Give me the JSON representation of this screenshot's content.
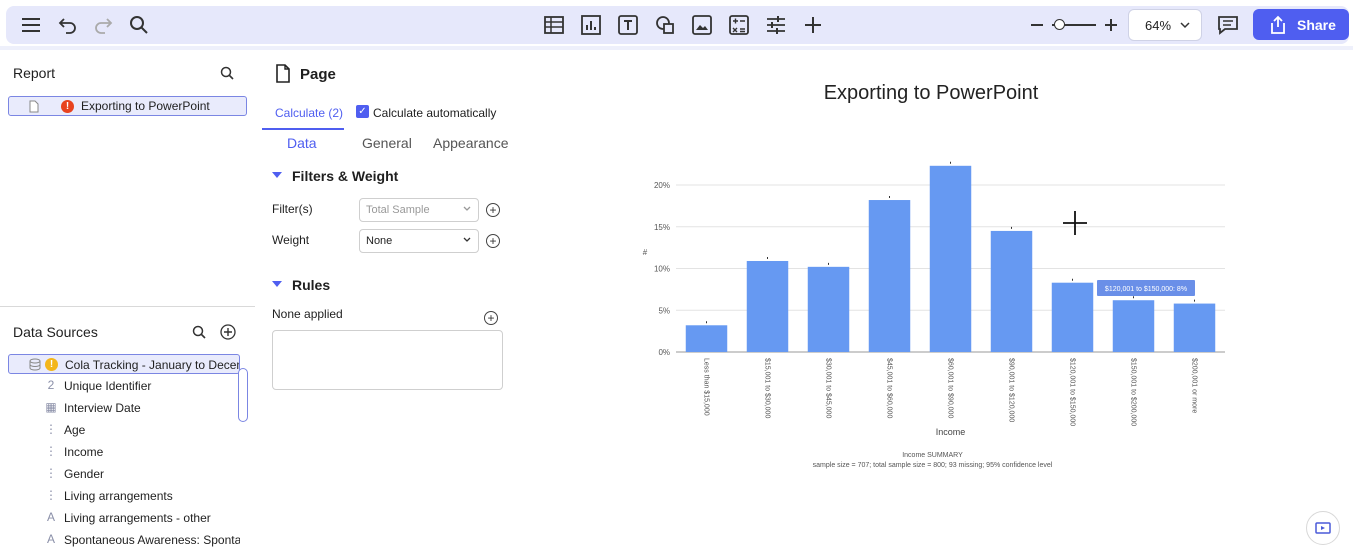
{
  "toolbar": {
    "left_icons": [
      "menu-icon",
      "undo-icon",
      "redo-icon",
      "search-icon"
    ],
    "center_icons": [
      "table-icon",
      "chart-icon",
      "text-icon",
      "shapes-icon",
      "image-icon",
      "calculation-icon",
      "controls-icon",
      "add-icon"
    ],
    "zoom_value": "64%",
    "share_label": "Share"
  },
  "report": {
    "title": "Report",
    "items": [
      {
        "label": "Exporting to PowerPoint",
        "error": "!"
      }
    ]
  },
  "data_sources": {
    "title": "Data Sources",
    "dataset": {
      "label": "Cola Tracking - January to December",
      "warning": "!"
    },
    "variables": [
      {
        "icon": "2",
        "label": "Unique Identifier"
      },
      {
        "icon": "▦",
        "label": "Interview Date"
      },
      {
        "icon": "⋮",
        "label": "Age"
      },
      {
        "icon": "⋮",
        "label": "Income"
      },
      {
        "icon": "⋮",
        "label": "Gender"
      },
      {
        "icon": "⋮",
        "label": "Living arrangements"
      },
      {
        "icon": "A",
        "label": "Living arrangements - other"
      },
      {
        "icon": "A",
        "label": "Spontaneous Awareness: Spontaneous"
      }
    ]
  },
  "panel": {
    "page_title": "Page",
    "calculate_tab": "Calculate (2)",
    "auto_label": "Calculate automatically",
    "auto_checked": "✓",
    "subtabs": [
      "Data",
      "General",
      "Appearance"
    ],
    "filters_weight_title": "Filters & Weight",
    "filter_label": "Filter(s)",
    "filter_placeholder": "Total Sample",
    "weight_label": "Weight",
    "weight_value": "None",
    "rules_title": "Rules",
    "rules_status": "None applied",
    "add_symbol": "+"
  },
  "chart_data": {
    "type": "bar",
    "title": "Exporting to PowerPoint",
    "xlabel": "Income",
    "ylabel": "#",
    "categories": [
      "Less than $15,000",
      "$15,001 to $30,000",
      "$30,001 to $45,000",
      "$45,001 to $60,000",
      "$60,001 to $90,000",
      "$90,001 to $120,000",
      "$120,001 to $150,000",
      "$150,001 to $200,000",
      "$200,001 or more"
    ],
    "values": [
      3.2,
      10.9,
      10.2,
      18.2,
      22.3,
      14.5,
      8.3,
      6.2,
      5.8
    ],
    "ylim": [
      0,
      20
    ],
    "yticks": [
      "0%",
      "5%",
      "10%",
      "15%",
      "20%"
    ],
    "grid": true,
    "color": "#6699f2",
    "tooltip": "$120,001 to $150,000: 8%",
    "footer_line1": "Income SUMMARY",
    "footer_line2": "sample size = 707; total sample size = 800; 93 missing; 95% confidence level"
  }
}
